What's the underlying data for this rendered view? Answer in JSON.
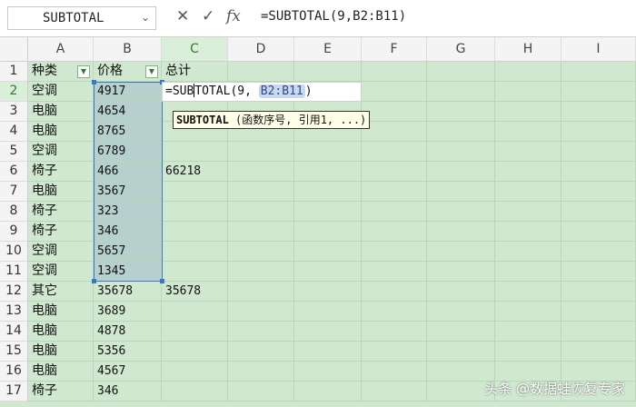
{
  "name_box": {
    "value": "SUBTOTAL",
    "arrow": "⌄"
  },
  "formula_bar": {
    "cancel_icon": "✕",
    "confirm_icon": "✓",
    "fx_label": "fx",
    "formula": "=SUBTOTAL(9,B2:B11)"
  },
  "columns": [
    "A",
    "B",
    "C",
    "D",
    "E",
    "F",
    "G",
    "H",
    "I"
  ],
  "rows": [
    "1",
    "2",
    "3",
    "4",
    "5",
    "6",
    "7",
    "8",
    "9",
    "10",
    "11",
    "12",
    "13",
    "14",
    "15",
    "16",
    "17"
  ],
  "cells": {
    "A": [
      "种类",
      "空调",
      "电脑",
      "电脑",
      "空调",
      "椅子",
      "电脑",
      "椅子",
      "椅子",
      "空调",
      "空调",
      "其它",
      "电脑",
      "电脑",
      "电脑",
      "电脑",
      "椅子"
    ],
    "B": [
      "价格",
      "4917",
      "4654",
      "8765",
      "6789",
      "466",
      "3567",
      "323",
      "346",
      "5657",
      "1345",
      "35678",
      "3689",
      "4878",
      "5356",
      "4567",
      "346"
    ],
    "C": [
      "总计",
      "",
      "",
      "",
      "",
      "66218",
      "",
      "",
      "",
      "",
      "",
      "35678",
      "",
      "",
      "",
      "",
      ""
    ]
  },
  "editing": {
    "prefix": "=SUB",
    "suffix": "TOTAL(9, ",
    "ref": "B2:B11",
    "close": ")"
  },
  "tooltip": {
    "func": "SUBTOTAL",
    "args": " (函数序号, 引用1, ...)"
  },
  "watermark": "头条 @数据蛙恢复专家",
  "colors": {
    "sheet_bg": "#cfe8cf",
    "selection": "#3f75c8",
    "selected_fill": "#b6d0cd"
  }
}
